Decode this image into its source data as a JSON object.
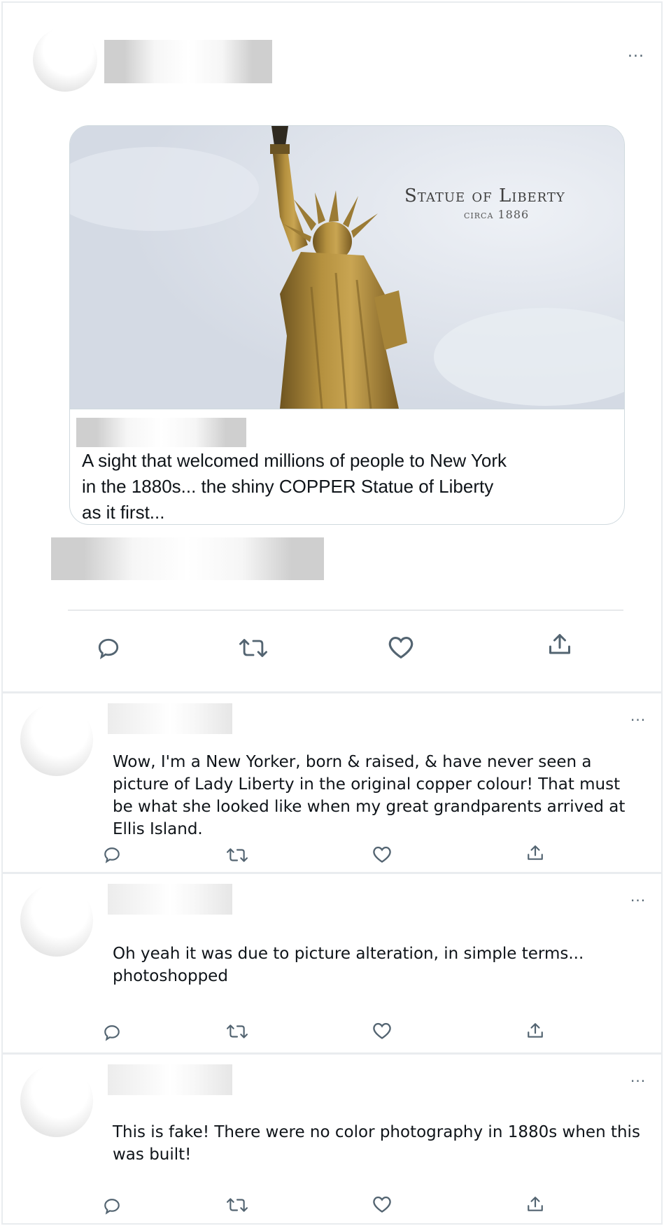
{
  "post": {
    "card_title_overlay": "Statue of Liberty",
    "card_subtitle_overlay": "circa 1886",
    "card_text": "A sight that welcomed millions of people to New York\n in the 1880s... the shiny COPPER Statue of Liberty\nas it first...",
    "more_label": "..."
  },
  "replies": [
    {
      "text": "Wow, I'm a New Yorker, born & raised, & have never seen a picture of Lady Liberty in the original copper colour! That must be what she looked like when my great grandparents arrived at Ellis Island.",
      "more_label": "..."
    },
    {
      "text": "Oh yeah it was due to picture alteration, in simple terms... photoshopped",
      "more_label": "..."
    },
    {
      "text": "This is fake! There were no color photography in 1880s when this was built!",
      "more_label": "..."
    }
  ],
  "icons": {
    "reply": "reply-icon",
    "retweet": "retweet-icon",
    "like": "like-icon",
    "share": "share-icon",
    "more": "more-icon"
  },
  "colors": {
    "icon_gray": "#536471",
    "border": "#cfd9de",
    "statue_copper": "#b08a3e"
  }
}
